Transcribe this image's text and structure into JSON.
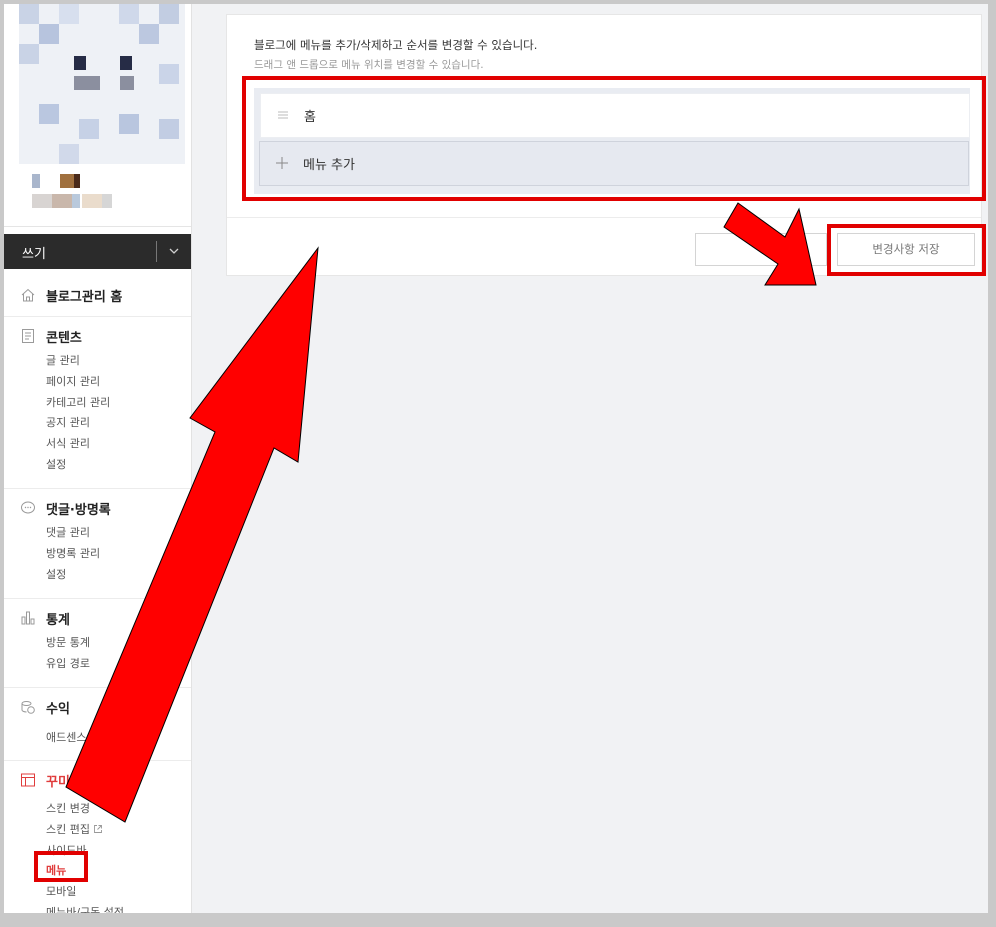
{
  "sidebar": {
    "write_label": "쓰기",
    "sections": {
      "home": {
        "title": "블로그관리 홈"
      },
      "contents": {
        "title": "콘텐츠",
        "items": [
          "글 관리",
          "페이지 관리",
          "카테고리 관리",
          "공지 관리",
          "서식 관리",
          "설정"
        ]
      },
      "comments": {
        "title": "댓글·방명록",
        "items": [
          "댓글 관리",
          "방명록 관리",
          "설정"
        ]
      },
      "stats": {
        "title": "통계",
        "items": [
          "방문 통계",
          "유입 경로"
        ]
      },
      "revenue": {
        "title": "수익",
        "items": [
          "애드센스 관리"
        ]
      },
      "customize": {
        "title": "꾸미기",
        "items": [
          "스킨 변경",
          "스킨 편집",
          "사이드바",
          "메뉴",
          "모바일",
          "메뉴바/구독 설정"
        ],
        "active_item": "메뉴"
      }
    }
  },
  "main": {
    "description": "블로그에 메뉴를 추가/삭제하고 순서를 변경할 수 있습니다.",
    "hint": "드래그 앤 드롭으로 메뉴 위치를 변경할 수 있습니다.",
    "menu_items": [
      {
        "label": "홈",
        "icon": "drag-handle-icon"
      },
      {
        "label": "메뉴 추가",
        "icon": "plus-icon"
      }
    ],
    "cancel_label": "",
    "save_label": "변경사항 저장"
  },
  "colors": {
    "annotation_red": "#e10000",
    "active_red": "#e03c3c",
    "sidebar_dark": "#2b2b2b"
  }
}
